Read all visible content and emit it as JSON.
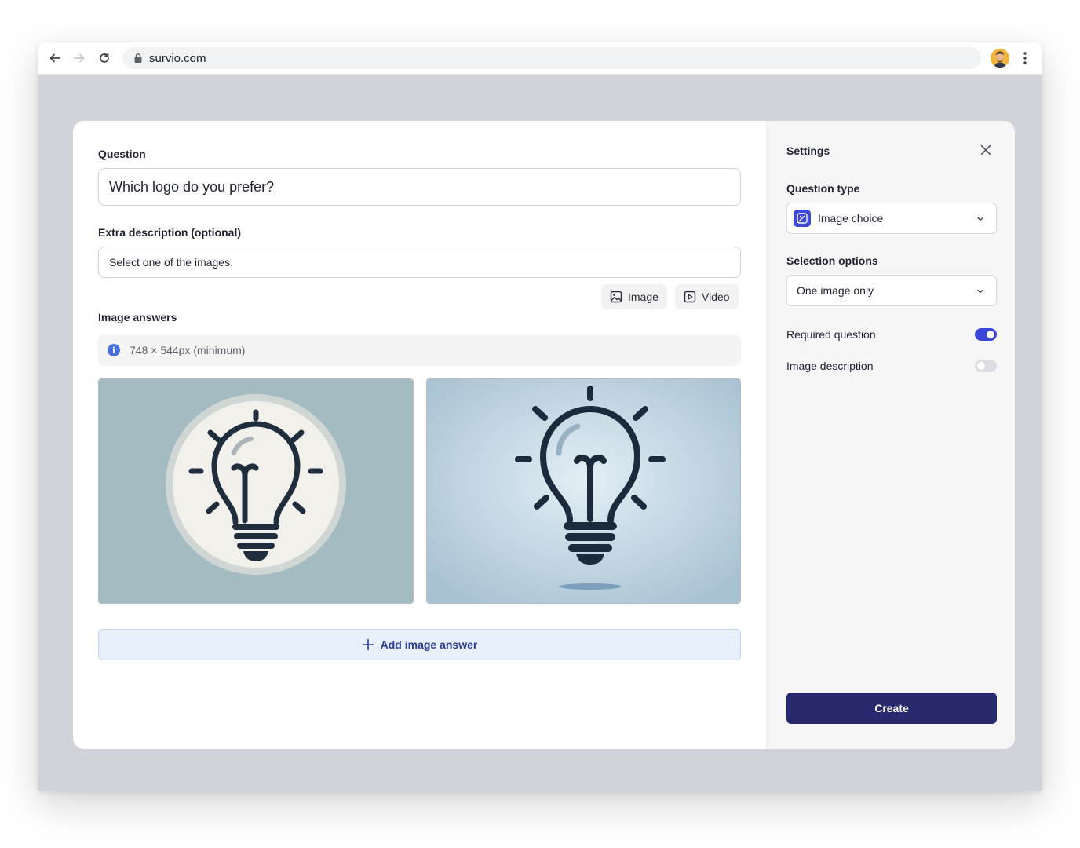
{
  "browser": {
    "url": "survio.com"
  },
  "editor": {
    "question_label": "Question",
    "question_value": "Which logo do you prefer?",
    "description_label": "Extra description (optional)",
    "description_value": "Select one of the images.",
    "attach_image_label": "Image",
    "attach_video_label": "Video",
    "image_answers_label": "Image answers",
    "image_size_hint": "748 × 544px (minimum)",
    "add_image_answer_label": "Add image answer"
  },
  "settings": {
    "title": "Settings",
    "question_type_label": "Question type",
    "question_type_value": "Image choice",
    "selection_options_label": "Selection options",
    "selection_options_value": "One image only",
    "required_question_label": "Required question",
    "required_question_on": true,
    "image_description_label": "Image description",
    "image_description_on": false,
    "create_label": "Create"
  },
  "colors": {
    "accent": "#3847d8",
    "primary_button": "#28296e",
    "add_button_bg": "#e8f0fc"
  },
  "icons": [
    "back-arrow-icon",
    "forward-arrow-icon",
    "reload-icon",
    "lock-icon",
    "kebab-menu-icon",
    "image-icon",
    "video-icon",
    "info-icon",
    "plus-icon",
    "close-icon",
    "image-choice-icon",
    "chevron-down-icon",
    "lightbulb-icon"
  ]
}
